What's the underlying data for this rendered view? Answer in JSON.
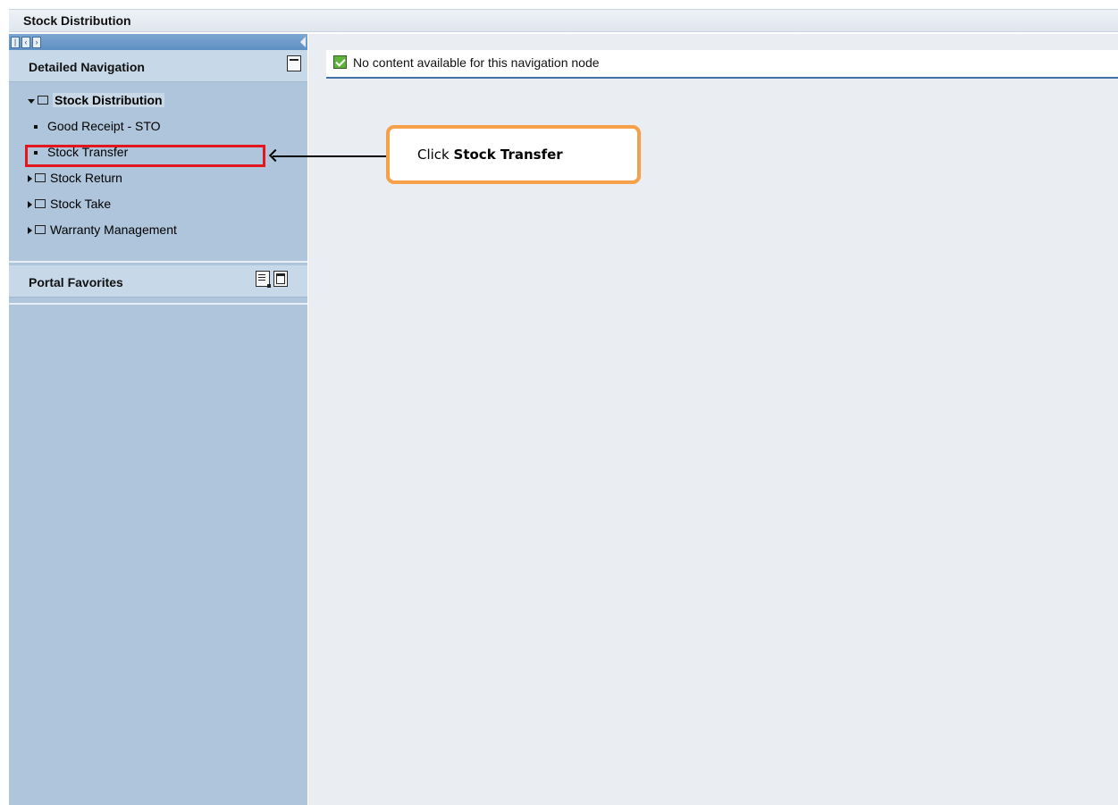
{
  "header": {
    "title": "Stock Distribution"
  },
  "sidebar": {
    "detailed_navigation": {
      "title": "Detailed Navigation",
      "tree": [
        {
          "label": "Stock Distribution",
          "expanded": true,
          "selected": true
        },
        {
          "label": "Good Receipt - STO"
        },
        {
          "label": "Stock Transfer"
        },
        {
          "label": "Stock Return"
        },
        {
          "label": "Stock Take"
        },
        {
          "label": "Warranty Management"
        }
      ]
    },
    "portal_favorites": {
      "title": "Portal Favorites"
    }
  },
  "main": {
    "message": "No content available for this navigation node"
  },
  "callout": {
    "prefix": "Click",
    "emphasis": "Stock Transfer"
  },
  "colors": {
    "highlight_border": "#e3161e",
    "callout_border": "#f6a04a",
    "sidebar_bg": "#aec5dc",
    "accent_blue": "#3f71a6"
  },
  "icons": [
    "minimize-icon",
    "list-icon",
    "window-icon",
    "folder-icon",
    "check-icon",
    "caret-down-icon",
    "caret-right-icon"
  ]
}
